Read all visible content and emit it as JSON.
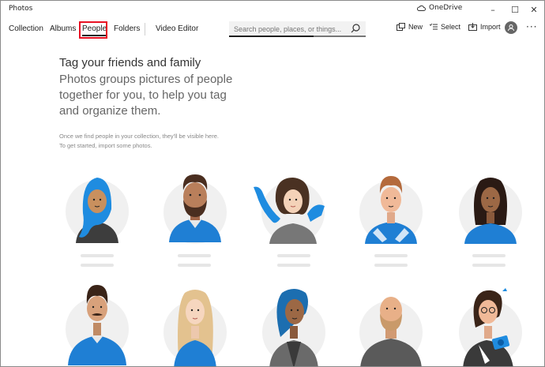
{
  "window": {
    "title": "Photos",
    "onedrive_label": "OneDrive",
    "minimize_glyph": "–",
    "maximize_glyph": "☐",
    "close_glyph": "✕"
  },
  "nav": {
    "items": [
      "Collection",
      "Albums",
      "People",
      "Folders",
      "Video Editor"
    ],
    "active": "People"
  },
  "search": {
    "placeholder": "Search people, places, or things..."
  },
  "toolbar": {
    "new_label": "New",
    "select_label": "Select",
    "import_label": "Import",
    "more_glyph": "···"
  },
  "content": {
    "headline": "Tag your friends and family",
    "subline": "Photos groups pictures of people together for you, to help you tag and organize them.",
    "hint_line1": "Once we find people in your collection, they'll be visible here.",
    "hint_line2": "To get started, import some photos."
  },
  "colors": {
    "accent": "#0078d7",
    "highlight": "#e81123",
    "circle_bg": "#f0f0f0",
    "placeholder_bar": "#e6e6e6"
  }
}
